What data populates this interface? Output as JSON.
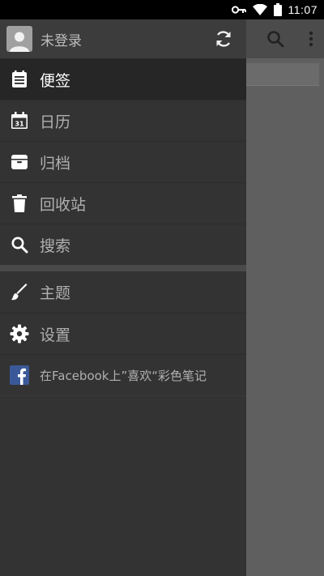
{
  "status": {
    "time": "11:07"
  },
  "drawer": {
    "account": {
      "label": "未登录"
    },
    "items": [
      {
        "label": "便签",
        "icon": "note-list-icon",
        "active": true
      },
      {
        "label": "日历",
        "icon": "calendar-icon",
        "day": "31"
      },
      {
        "label": "归档",
        "icon": "archive-icon"
      },
      {
        "label": "回收站",
        "icon": "trash-icon"
      },
      {
        "label": "搜索",
        "icon": "search-icon"
      }
    ],
    "items2": [
      {
        "label": "主题",
        "icon": "brush-icon"
      },
      {
        "label": "设置",
        "icon": "gear-icon"
      },
      {
        "label": "在Facebook上”喜欢“彩色笔记",
        "icon": "facebook-icon"
      }
    ]
  }
}
